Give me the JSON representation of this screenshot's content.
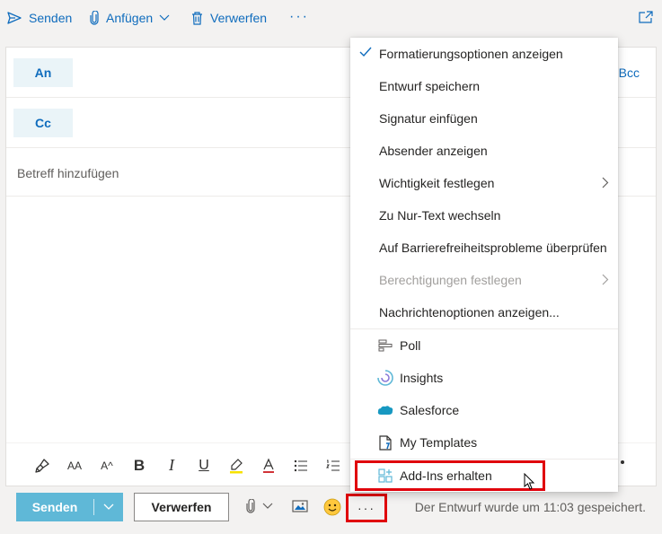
{
  "toolbar": {
    "send_label": "Senden",
    "attach_label": "Anfügen",
    "discard_label": "Verwerfen",
    "more_label": "···"
  },
  "compose": {
    "to_label": "An",
    "cc_label": "Cc",
    "bcc_label": "Bcc",
    "subject_placeholder": "Betreff hinzufügen"
  },
  "formatting": {
    "font_size_label": "AA",
    "grow_label": "A^",
    "bold_label": "B",
    "italic_label": "I",
    "underline_label": "U",
    "font_color_label": "A"
  },
  "bottom": {
    "send_label": "Senden",
    "discard_label": "Verwerfen",
    "more_label": "···",
    "saved_status": "Der Entwurf wurde um 11:03 gespeichert."
  },
  "menu": {
    "items": [
      {
        "label": "Formatierungsoptionen anzeigen",
        "checked": true
      },
      {
        "label": "Entwurf speichern"
      },
      {
        "label": "Signatur einfügen"
      },
      {
        "label": "Absender anzeigen"
      },
      {
        "label": "Wichtigkeit festlegen",
        "submenu": true
      },
      {
        "label": "Zu Nur-Text wechseln"
      },
      {
        "label": "Auf Barrierefreiheitsprobleme überprüfen"
      },
      {
        "label": "Berechtigungen festlegen",
        "submenu": true,
        "disabled": true
      },
      {
        "label": "Nachrichtenoptionen anzeigen..."
      }
    ],
    "addins": [
      {
        "label": "Poll",
        "icon": "poll-icon"
      },
      {
        "label": "Insights",
        "icon": "insights-icon"
      },
      {
        "label": "Salesforce",
        "icon": "salesforce-icon"
      },
      {
        "label": "My Templates",
        "icon": "templates-icon"
      },
      {
        "label": "Add-Ins erhalten",
        "icon": "get-addins-icon"
      }
    ]
  },
  "colors": {
    "accent": "#0f6cbd",
    "send_button": "#5fb8d7",
    "highlight_box": "#e0000b"
  }
}
